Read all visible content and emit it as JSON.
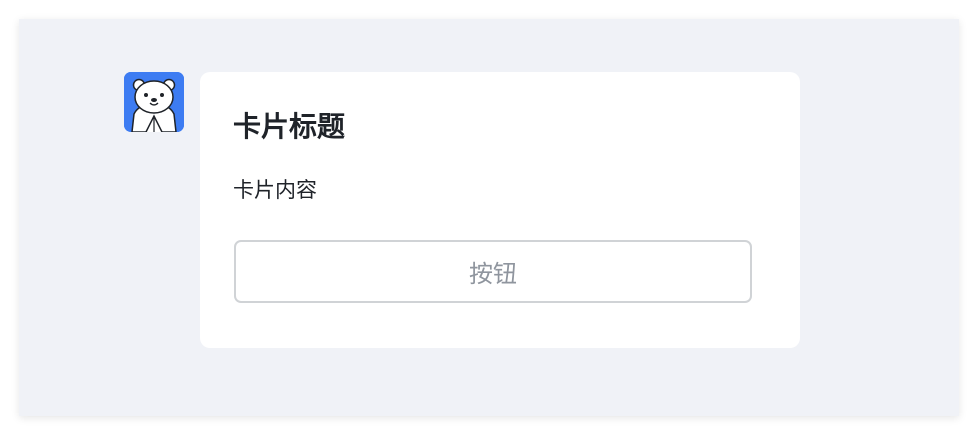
{
  "avatar": {
    "icon": "bot-avatar-icon",
    "background_color": "#3d7cf2"
  },
  "card": {
    "title": "卡片标题",
    "content": "卡片内容",
    "button_label": "按钮"
  },
  "colors": {
    "page_background": "#f0f2f7",
    "card_background": "#ffffff",
    "title_text": "#1f2329",
    "button_text": "#8f959e",
    "button_border": "#d0d3d6"
  }
}
